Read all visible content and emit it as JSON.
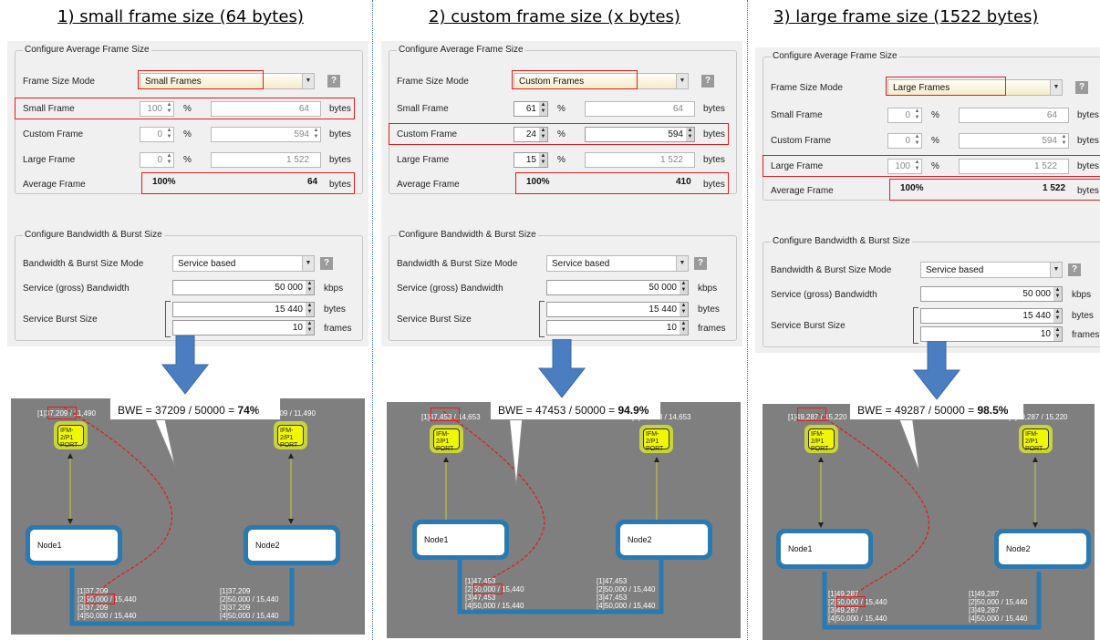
{
  "columns": [
    {
      "title": "1) small frame size (64 bytes)",
      "frame_size": {
        "group_title": "Configure Average Frame Size",
        "mode_label": "Frame Size Mode",
        "mode_value": "Small Frames",
        "help": "?",
        "small": {
          "label": "Small Frame",
          "pct": "100",
          "bytes": "64"
        },
        "custom": {
          "label": "Custom Frame",
          "pct": "0",
          "bytes": "594"
        },
        "large": {
          "label": "Large Frame",
          "pct": "0",
          "bytes": "1 522"
        },
        "average": {
          "label": "Average Frame",
          "pct": "100%",
          "bytes": "64"
        },
        "pct_unit": "%",
        "bytes_unit": "bytes"
      },
      "bandwidth": {
        "group_title": "Configure Bandwidth & Burst Size",
        "mode_label": "Bandwidth & Burst Size Mode",
        "mode_value": "Service based",
        "help": "?",
        "bw_label": "Service (gross) Bandwidth",
        "bw_value": "50 000",
        "bw_unit": "kbps",
        "burst_label": "Service Burst Size",
        "burst_bytes": "15 440",
        "burst_bytes_unit": "bytes",
        "burst_frames": "10",
        "burst_frames_unit": "frames"
      },
      "diagram": {
        "bwe_prefix": "BWE = 37209 / 50000 = ",
        "bwe_value": "74%",
        "top_left_prefix": "[1]",
        "top_left_value": "37,209",
        "top_left_suffix": " / 11,490",
        "top_right": "[1]37,209 / 11,490",
        "port_left": "IFM-2/P1 PORT",
        "port_right": "IFM-2/P1 PORT",
        "node_left": "Node1",
        "node_right": "Node2",
        "bl1": "[1]37,209",
        "bl2_prefix": "[2]",
        "bl2_value": "50,000",
        "bl2_suffix": " / 15,440",
        "bl3": "[3]37,209",
        "bl4": "[4]50,000 / 15,440",
        "br1": "[1]37,209",
        "br2": "[2]50,000 / 15,440",
        "br3": "[3]37,209",
        "br4": "[4]50,000 / 15,440"
      }
    },
    {
      "title": "2) custom frame size (x bytes)",
      "frame_size": {
        "group_title": "Configure Average Frame Size",
        "mode_label": "Frame Size Mode",
        "mode_value": "Custom Frames",
        "help": "?",
        "small": {
          "label": "Small Frame",
          "pct": "61",
          "bytes": "64"
        },
        "custom": {
          "label": "Custom Frame",
          "pct": "24",
          "bytes": "594"
        },
        "large": {
          "label": "Large Frame",
          "pct": "15",
          "bytes": "1 522"
        },
        "average": {
          "label": "Average Frame",
          "pct": "100%",
          "bytes": "410"
        },
        "pct_unit": "%",
        "bytes_unit": "bytes"
      },
      "bandwidth": {
        "group_title": "Configure Bandwidth & Burst Size",
        "mode_label": "Bandwidth & Burst Size Mode",
        "mode_value": "Service based",
        "help": "?",
        "bw_label": "Service (gross) Bandwidth",
        "bw_value": "50 000",
        "bw_unit": "kbps",
        "burst_label": "Service Burst Size",
        "burst_bytes": "15 440",
        "burst_bytes_unit": "bytes",
        "burst_frames": "10",
        "burst_frames_unit": "frames"
      },
      "diagram": {
        "bwe_prefix": "BWE = 47453 / 50000 = ",
        "bwe_value": "94.9%",
        "top_left_prefix": "[1]",
        "top_left_value": "47,453",
        "top_left_suffix": " / 14,653",
        "top_right": "[1]47,453 / 14,653",
        "port_left": "IFM-2/P1 PORT",
        "port_right": "IFM-2/P1 PORT",
        "node_left": "Node1",
        "node_right": "Node2",
        "bl1": "[1]47,453",
        "bl2_prefix": "[2]",
        "bl2_value": "50,000",
        "bl2_suffix": " / 15,440",
        "bl3": "[3]47,453",
        "bl4": "[4]50,000 / 15,440",
        "br1": "[1]47,453",
        "br2": "[2]50,000 / 15,440",
        "br3": "[3]47,453",
        "br4": "[4]50,000 / 15,440"
      }
    },
    {
      "title": "3) large frame size (1522 bytes)",
      "frame_size": {
        "group_title": "Configure Average Frame Size",
        "mode_label": "Frame Size Mode",
        "mode_value": "Large Frames",
        "help": "?",
        "small": {
          "label": "Small Frame",
          "pct": "0",
          "bytes": "64"
        },
        "custom": {
          "label": "Custom Frame",
          "pct": "0",
          "bytes": "594"
        },
        "large": {
          "label": "Large Frame",
          "pct": "100",
          "bytes": "1 522"
        },
        "average": {
          "label": "Average Frame",
          "pct": "100%",
          "bytes": "1 522"
        },
        "pct_unit": "%",
        "bytes_unit": "bytes"
      },
      "bandwidth": {
        "group_title": "Configure Bandwidth & Burst Size",
        "mode_label": "Bandwidth & Burst Size Mode",
        "mode_value": "Service based",
        "help": "?",
        "bw_label": "Service (gross) Bandwidth",
        "bw_value": "50 000",
        "bw_unit": "kbps",
        "burst_label": "Service Burst Size",
        "burst_bytes": "15 440",
        "burst_bytes_unit": "bytes",
        "burst_frames": "10",
        "burst_frames_unit": "frames"
      },
      "diagram": {
        "bwe_prefix": "BWE = 49287 / 50000 = ",
        "bwe_value": "98.5%",
        "top_left_prefix": "[1]",
        "top_left_value": "49,287",
        "top_left_suffix": " / 15,220",
        "top_right": "[1]49,287 / 15,220",
        "port_left": "IFM-2/P1 PORT",
        "port_right": "IFM-2/P1 PORT",
        "node_left": "Node1",
        "node_right": "Node2",
        "bl1": "[1]49,287",
        "bl2_prefix": "[2]",
        "bl2_value": "50,000",
        "bl2_suffix": " / 15,440",
        "bl3": "[3]49,287",
        "bl4": "[4]50,000 / 15,440",
        "br1": "[1]49,287",
        "br2": "[2]50,000 / 15,440",
        "br3": "[3]49,287",
        "br4": "[4]50,000 / 15,440"
      }
    }
  ]
}
